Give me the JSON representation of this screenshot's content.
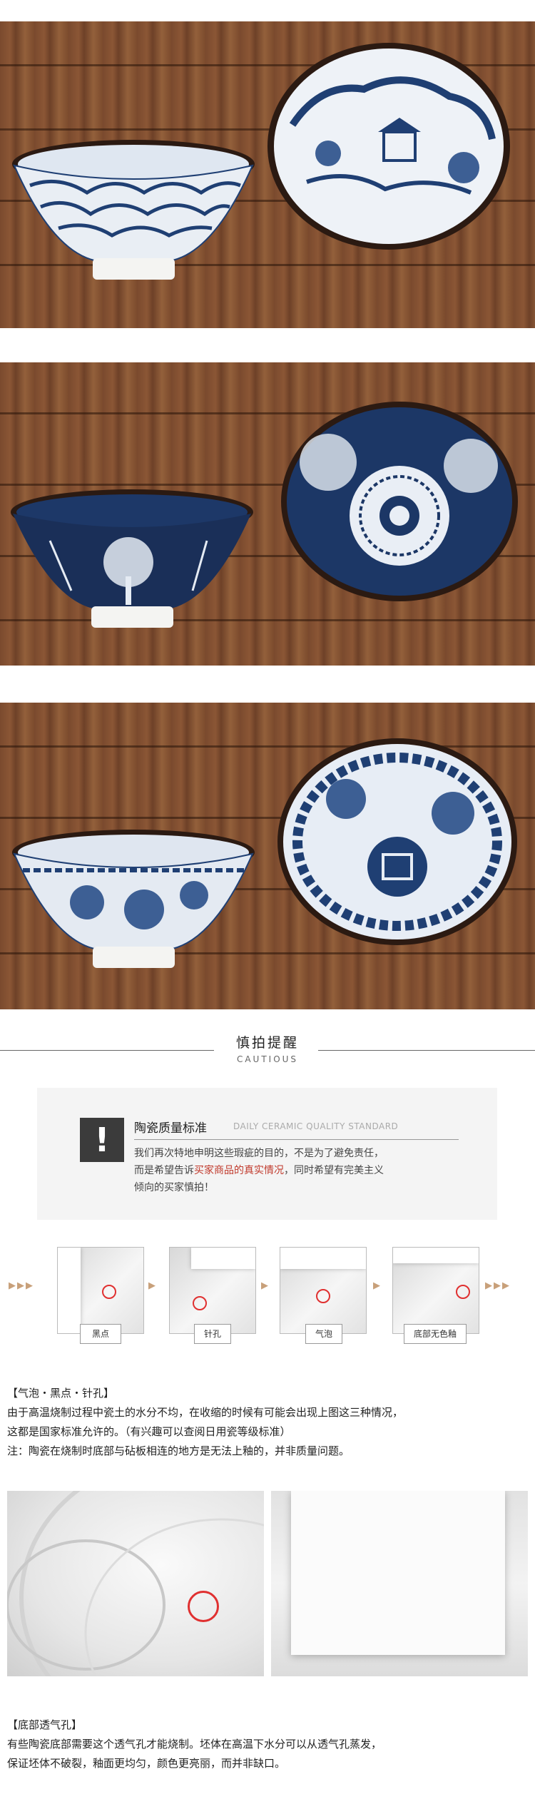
{
  "caution": {
    "title_cn": "慎拍提醒",
    "title_en": "CAUTIOUS"
  },
  "standard": {
    "icon": "!",
    "title": "陶瓷质量标准",
    "subtitle": "DAILY CERAMIC QUALITY STANDARD",
    "text_1": "我们再次特地申明这些瑕疵的目的，不是为了避免责任，",
    "text_2_pre": "而是希望告诉",
    "text_2_highlight": "买家商品的真实情况",
    "text_2_post": "，同时希望有完美主义",
    "text_3": "倾向的买家慎拍！"
  },
  "defects": [
    {
      "label": "黑点"
    },
    {
      "label": "针孔"
    },
    {
      "label": "气泡"
    },
    {
      "label": "底部无色釉"
    }
  ],
  "section1": {
    "heading": "【气泡・黑点・针孔】",
    "line_1": "由于高温烧制过程中瓷土的水分不均，在收缩的时候有可能会出现上图这三种情况，",
    "line_2": "这都是国家标准允许的。（有兴趣可以查阅日用瓷等级标准）",
    "line_3": "注：陶瓷在烧制时底部与砧板相连的地方是无法上釉的，并非质量问题。"
  },
  "section2": {
    "heading": "【底部透气孔】",
    "line_1": "有些陶瓷底部需要这个透气孔才能烧制。坯体在高温下水分可以从透气孔蒸发，",
    "line_2": "保证坯体不破裂，釉面更均匀，颜色更亮丽，而并非缺口。"
  },
  "colors": {
    "accent_red": "#c0392b",
    "porcelain_blue": "#1f3f73",
    "wood": "#7a4a2e"
  }
}
